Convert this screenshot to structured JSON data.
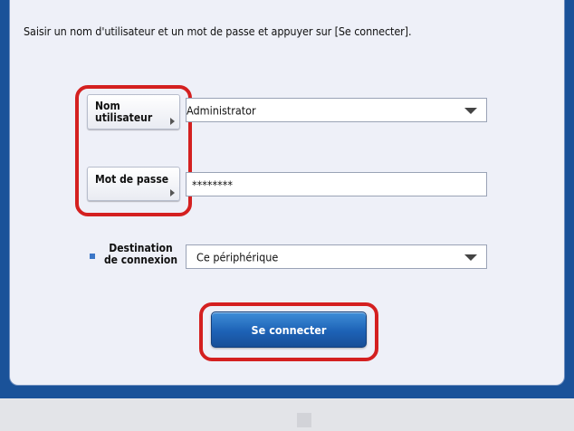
{
  "instruction": "Saisir un nom d'utilisateur et un mot de passe et appuyer sur [Se connecter].",
  "username": {
    "label_line1": "Nom",
    "label_line2": "utilisateur",
    "value": "Administrator"
  },
  "password": {
    "label": "Mot de passe",
    "value": "********"
  },
  "destination": {
    "label_line1": "Destination",
    "label_line2": "de connexion",
    "value": "Ce périphérique"
  },
  "login_button": {
    "label": "Se connecter"
  },
  "colors": {
    "frame": "#1a5299",
    "panel": "#eef0f8",
    "highlight": "#d42020",
    "button": "#1d62b6"
  }
}
